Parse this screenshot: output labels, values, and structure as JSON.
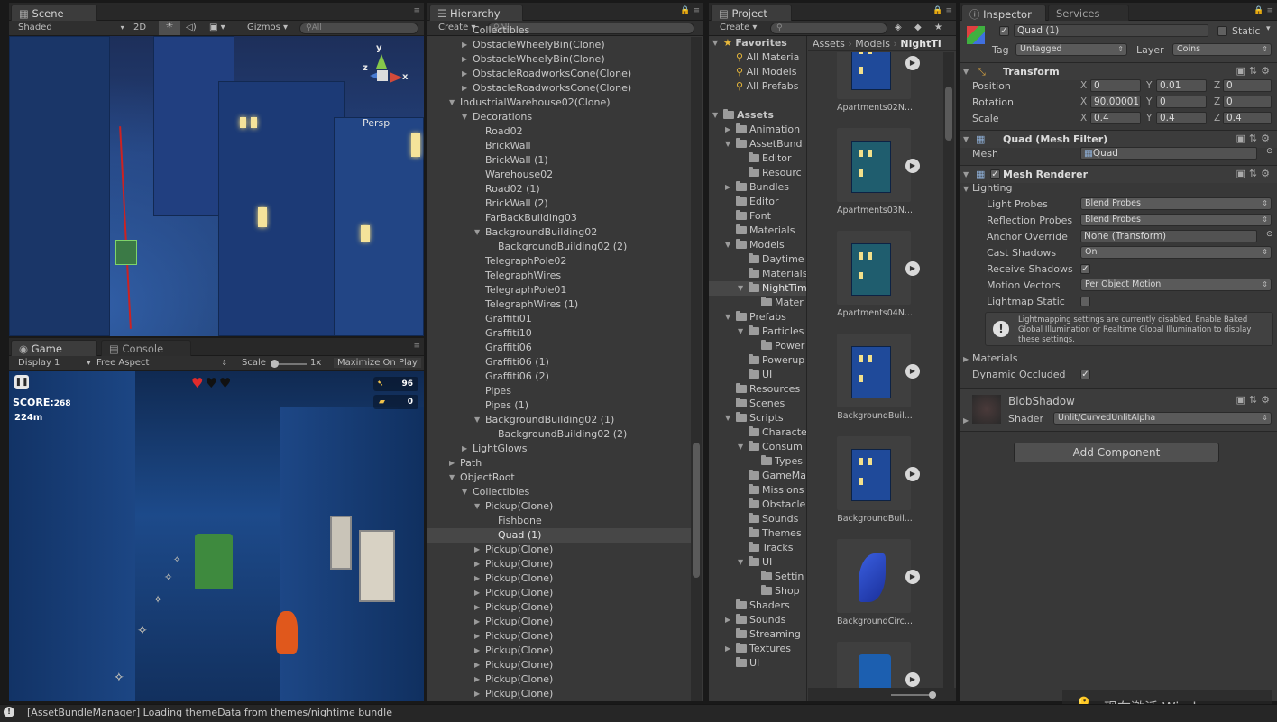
{
  "scene": {
    "tab": "Scene",
    "shading": "Shaded",
    "mode_2d": "2D",
    "gizmos": "Gizmos",
    "search_placeholder": "All",
    "persp": "Persp",
    "axis_x": "x",
    "axis_y": "y",
    "axis_z": "z"
  },
  "game": {
    "tab_game": "Game",
    "tab_console": "Console",
    "display": "Display 1",
    "aspect": "Free Aspect",
    "scale_label": "Scale",
    "scale_value": "1x",
    "maximize": "Maximize On Play",
    "score_label": "SCORE:",
    "score_value": "268",
    "distance": "224m",
    "fish_count": "96",
    "premium_count": "0"
  },
  "hierarchy": {
    "tab": "Hierarchy",
    "create": "Create",
    "search_placeholder": "All",
    "rows": [
      {
        "label": "Collectibles",
        "indent": 3,
        "arrow": "",
        "partial": true
      },
      {
        "label": "ObstacleWheelyBin(Clone)",
        "indent": 3,
        "arrow": "▶"
      },
      {
        "label": "ObstacleWheelyBin(Clone)",
        "indent": 3,
        "arrow": "▶"
      },
      {
        "label": "ObstacleRoadworksCone(Clone)",
        "indent": 3,
        "arrow": "▶"
      },
      {
        "label": "ObstacleRoadworksCone(Clone)",
        "indent": 3,
        "arrow": "▶"
      },
      {
        "label": "IndustrialWarehouse02(Clone)",
        "indent": 2,
        "arrow": "▼"
      },
      {
        "label": "Decorations",
        "indent": 3,
        "arrow": "▼"
      },
      {
        "label": "Road02",
        "indent": 4,
        "arrow": ""
      },
      {
        "label": "BrickWall",
        "indent": 4,
        "arrow": ""
      },
      {
        "label": "BrickWall (1)",
        "indent": 4,
        "arrow": ""
      },
      {
        "label": "Warehouse02",
        "indent": 4,
        "arrow": ""
      },
      {
        "label": "Road02 (1)",
        "indent": 4,
        "arrow": ""
      },
      {
        "label": "BrickWall (2)",
        "indent": 4,
        "arrow": ""
      },
      {
        "label": "FarBackBuilding03",
        "indent": 4,
        "arrow": ""
      },
      {
        "label": "BackgroundBuilding02",
        "indent": 4,
        "arrow": "▼"
      },
      {
        "label": "BackgroundBuilding02 (2)",
        "indent": 5,
        "arrow": ""
      },
      {
        "label": "TelegraphPole02",
        "indent": 4,
        "arrow": ""
      },
      {
        "label": "TelegraphWires",
        "indent": 4,
        "arrow": ""
      },
      {
        "label": "TelegraphPole01",
        "indent": 4,
        "arrow": ""
      },
      {
        "label": "TelegraphWires (1)",
        "indent": 4,
        "arrow": ""
      },
      {
        "label": "Graffiti01",
        "indent": 4,
        "arrow": ""
      },
      {
        "label": "Graffiti10",
        "indent": 4,
        "arrow": ""
      },
      {
        "label": "Graffiti06",
        "indent": 4,
        "arrow": ""
      },
      {
        "label": "Graffiti06 (1)",
        "indent": 4,
        "arrow": ""
      },
      {
        "label": "Graffiti06 (2)",
        "indent": 4,
        "arrow": ""
      },
      {
        "label": "Pipes",
        "indent": 4,
        "arrow": ""
      },
      {
        "label": "Pipes (1)",
        "indent": 4,
        "arrow": ""
      },
      {
        "label": "BackgroundBuilding02 (1)",
        "indent": 4,
        "arrow": "▼"
      },
      {
        "label": "BackgroundBuilding02 (2)",
        "indent": 5,
        "arrow": ""
      },
      {
        "label": "LightGlows",
        "indent": 3,
        "arrow": "▶"
      },
      {
        "label": "Path",
        "indent": 2,
        "arrow": "▶"
      },
      {
        "label": "ObjectRoot",
        "indent": 2,
        "arrow": "▼"
      },
      {
        "label": "Collectibles",
        "indent": 3,
        "arrow": "▼"
      },
      {
        "label": "Pickup(Clone)",
        "indent": 4,
        "arrow": "▼"
      },
      {
        "label": "Fishbone",
        "indent": 5,
        "arrow": ""
      },
      {
        "label": "Quad (1)",
        "indent": 5,
        "arrow": "",
        "selected": true
      },
      {
        "label": "Pickup(Clone)",
        "indent": 4,
        "arrow": "▶"
      },
      {
        "label": "Pickup(Clone)",
        "indent": 4,
        "arrow": "▶"
      },
      {
        "label": "Pickup(Clone)",
        "indent": 4,
        "arrow": "▶"
      },
      {
        "label": "Pickup(Clone)",
        "indent": 4,
        "arrow": "▶"
      },
      {
        "label": "Pickup(Clone)",
        "indent": 4,
        "arrow": "▶"
      },
      {
        "label": "Pickup(Clone)",
        "indent": 4,
        "arrow": "▶"
      },
      {
        "label": "Pickup(Clone)",
        "indent": 4,
        "arrow": "▶"
      },
      {
        "label": "Pickup(Clone)",
        "indent": 4,
        "arrow": "▶"
      },
      {
        "label": "Pickup(Clone)",
        "indent": 4,
        "arrow": "▶"
      },
      {
        "label": "Pickup(Clone)",
        "indent": 4,
        "arrow": "▶"
      },
      {
        "label": "Pickup(Clone)",
        "indent": 4,
        "arrow": "▶"
      }
    ]
  },
  "project": {
    "tab": "Project",
    "create": "Create",
    "breadcrumb": [
      "Assets",
      "Models",
      "NightTi"
    ],
    "tree": [
      {
        "label": "Favorites",
        "indent": 0,
        "arrow": "▼",
        "type": "star-header"
      },
      {
        "label": "All Materia",
        "indent": 1,
        "arrow": "",
        "type": "search"
      },
      {
        "label": "All Models",
        "indent": 1,
        "arrow": "",
        "type": "search"
      },
      {
        "label": "All Prefabs",
        "indent": 1,
        "arrow": "",
        "type": "search"
      },
      {
        "label": "",
        "indent": 0,
        "arrow": "",
        "type": "blank"
      },
      {
        "label": "Assets",
        "indent": 0,
        "arrow": "▼",
        "type": "folder-header"
      },
      {
        "label": "Animation",
        "indent": 1,
        "arrow": "▶",
        "type": "folder"
      },
      {
        "label": "AssetBund",
        "indent": 1,
        "arrow": "▼",
        "type": "folder"
      },
      {
        "label": "Editor",
        "indent": 2,
        "arrow": "",
        "type": "folder"
      },
      {
        "label": "Resourc",
        "indent": 2,
        "arrow": "",
        "type": "folder"
      },
      {
        "label": "Bundles",
        "indent": 1,
        "arrow": "▶",
        "type": "folder"
      },
      {
        "label": "Editor",
        "indent": 1,
        "arrow": "",
        "type": "folder"
      },
      {
        "label": "Font",
        "indent": 1,
        "arrow": "",
        "type": "folder"
      },
      {
        "label": "Materials",
        "indent": 1,
        "arrow": "",
        "type": "folder"
      },
      {
        "label": "Models",
        "indent": 1,
        "arrow": "▼",
        "type": "folder"
      },
      {
        "label": "Daytime",
        "indent": 2,
        "arrow": "",
        "type": "folder"
      },
      {
        "label": "Materials",
        "indent": 2,
        "arrow": "",
        "type": "folder"
      },
      {
        "label": "NightTim",
        "indent": 2,
        "arrow": "▼",
        "type": "folder",
        "selected": true
      },
      {
        "label": "Mater",
        "indent": 3,
        "arrow": "",
        "type": "folder"
      },
      {
        "label": "Prefabs",
        "indent": 1,
        "arrow": "▼",
        "type": "folder"
      },
      {
        "label": "Particles",
        "indent": 2,
        "arrow": "▼",
        "type": "folder"
      },
      {
        "label": "Power",
        "indent": 3,
        "arrow": "",
        "type": "folder"
      },
      {
        "label": "Powerup",
        "indent": 2,
        "arrow": "",
        "type": "folder"
      },
      {
        "label": "UI",
        "indent": 2,
        "arrow": "",
        "type": "folder"
      },
      {
        "label": "Resources",
        "indent": 1,
        "arrow": "",
        "type": "folder"
      },
      {
        "label": "Scenes",
        "indent": 1,
        "arrow": "",
        "type": "folder"
      },
      {
        "label": "Scripts",
        "indent": 1,
        "arrow": "▼",
        "type": "folder"
      },
      {
        "label": "Characte",
        "indent": 2,
        "arrow": "",
        "type": "folder"
      },
      {
        "label": "Consum",
        "indent": 2,
        "arrow": "▼",
        "type": "folder"
      },
      {
        "label": "Types",
        "indent": 3,
        "arrow": "",
        "type": "folder"
      },
      {
        "label": "GameMa",
        "indent": 2,
        "arrow": "",
        "type": "folder"
      },
      {
        "label": "Missions",
        "indent": 2,
        "arrow": "",
        "type": "folder"
      },
      {
        "label": "Obstacle",
        "indent": 2,
        "arrow": "",
        "type": "folder"
      },
      {
        "label": "Sounds",
        "indent": 2,
        "arrow": "",
        "type": "folder"
      },
      {
        "label": "Themes",
        "indent": 2,
        "arrow": "",
        "type": "folder"
      },
      {
        "label": "Tracks",
        "indent": 2,
        "arrow": "",
        "type": "folder"
      },
      {
        "label": "UI",
        "indent": 2,
        "arrow": "▼",
        "type": "folder"
      },
      {
        "label": "Settin",
        "indent": 3,
        "arrow": "",
        "type": "folder"
      },
      {
        "label": "Shop",
        "indent": 3,
        "arrow": "",
        "type": "folder"
      },
      {
        "label": "Shaders",
        "indent": 1,
        "arrow": "",
        "type": "folder"
      },
      {
        "label": "Sounds",
        "indent": 1,
        "arrow": "▶",
        "type": "folder"
      },
      {
        "label": "Streaming",
        "indent": 1,
        "arrow": "",
        "type": "folder"
      },
      {
        "label": "Textures",
        "indent": 1,
        "arrow": "▶",
        "type": "folder"
      },
      {
        "label": "UI",
        "indent": 1,
        "arrow": "",
        "type": "folder"
      }
    ],
    "assets": [
      {
        "label": "Apartments02N...",
        "kind": "bldg-blue"
      },
      {
        "label": "Apartments03N...",
        "kind": "bldg-teal"
      },
      {
        "label": "Apartments04N...",
        "kind": "bldg-teal"
      },
      {
        "label": "BackgroundBuil...",
        "kind": "bldg-blue"
      },
      {
        "label": "BackgroundBuil...",
        "kind": "bldg-blue"
      },
      {
        "label": "BackgroundCirc...",
        "kind": "leaf"
      },
      {
        "label": "",
        "kind": "bin"
      }
    ]
  },
  "inspector": {
    "tab": "Inspector",
    "tab_services": "Services",
    "object_name": "Quad (1)",
    "static_label": "Static",
    "tag_label": "Tag",
    "tag_value": "Untagged",
    "layer_label": "Layer",
    "layer_value": "Coins",
    "transform": {
      "title": "Transform",
      "position_label": "Position",
      "rotation_label": "Rotation",
      "scale_label": "Scale",
      "position": {
        "x": "0",
        "y": "0.01",
        "z": "0"
      },
      "rotation": {
        "x": "90.00001",
        "y": "0",
        "z": "0"
      },
      "scale": {
        "x": "0.4",
        "y": "0.4",
        "z": "0.4"
      }
    },
    "mesh_filter": {
      "title": "Quad (Mesh Filter)",
      "mesh_label": "Mesh",
      "mesh_value": "Quad"
    },
    "mesh_renderer": {
      "title": "Mesh Renderer",
      "lighting_label": "Lighting",
      "light_probes_label": "Light Probes",
      "light_probes_value": "Blend Probes",
      "reflection_probes_label": "Reflection Probes",
      "reflection_probes_value": "Blend Probes",
      "anchor_override_label": "Anchor Override",
      "anchor_override_value": "None (Transform)",
      "cast_shadows_label": "Cast Shadows",
      "cast_shadows_value": "On",
      "receive_shadows_label": "Receive Shadows",
      "motion_vectors_label": "Motion Vectors",
      "motion_vectors_value": "Per Object Motion",
      "lightmap_static_label": "Lightmap Static",
      "info_text": "Lightmapping settings are currently disabled. Enable Baked Global Illumination or Realtime Global Illumination to display these settings.",
      "materials_label": "Materials",
      "dynamic_occluded_label": "Dynamic Occluded"
    },
    "material": {
      "name": "BlobShadow",
      "shader_label": "Shader",
      "shader_value": "Unlit/CurvedUnlitAlpha"
    },
    "add_component": "Add Component"
  },
  "statusbar": {
    "message": "[AssetBundleManager] Loading themeData from themes/nightime bundle"
  },
  "watermark": {
    "text": "现在激活 Windows"
  },
  "colors": {
    "panel_bg": "#383838",
    "selection": "#474747",
    "accent_blue": "#3b6fc6",
    "toolbar": "#2f2f2f"
  }
}
